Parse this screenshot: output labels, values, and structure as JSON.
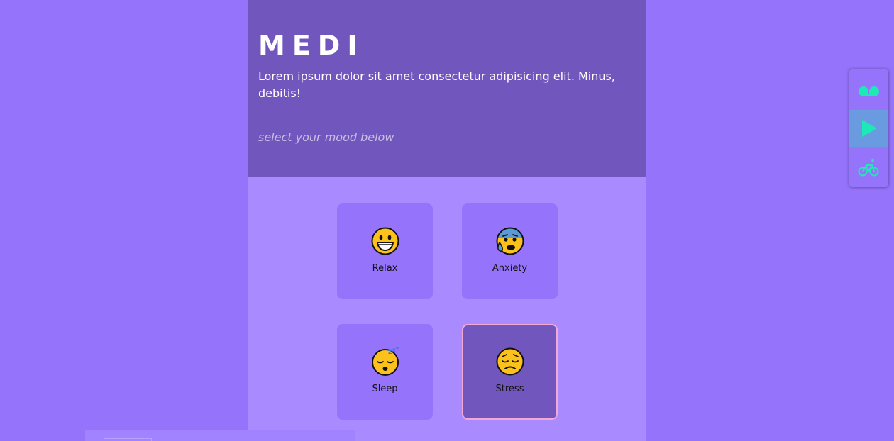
{
  "header": {
    "brand": "MEDI",
    "intro": "Lorem ipsum dolor sit amet consectetur adipisicing elit. Minus, debitis!",
    "prompt": "select your mood below"
  },
  "moods": [
    {
      "label": "Relax",
      "icon": "grinning-face-icon"
    },
    {
      "label": "Anxiety",
      "icon": "anxious-face-with-sweat-icon"
    },
    {
      "label": "Sleep",
      "icon": "sleeping-face-icon"
    },
    {
      "label": "Stress",
      "icon": "pensive-face-icon"
    }
  ],
  "selected_mood": "Stress",
  "side_panel": {
    "items": [
      {
        "icon": "voicemail-icon"
      },
      {
        "icon": "play-icon",
        "active": true
      },
      {
        "icon": "bicycle-icon"
      }
    ]
  },
  "colors": {
    "page_background": "#9573fb",
    "header_background": "#7157bd",
    "content_background": "#a98aff",
    "card_background": "#9573fb",
    "selected_card_border": "#f3a8d6",
    "accent": "#1de9b6",
    "active_side_item": "#6a9ae0"
  }
}
